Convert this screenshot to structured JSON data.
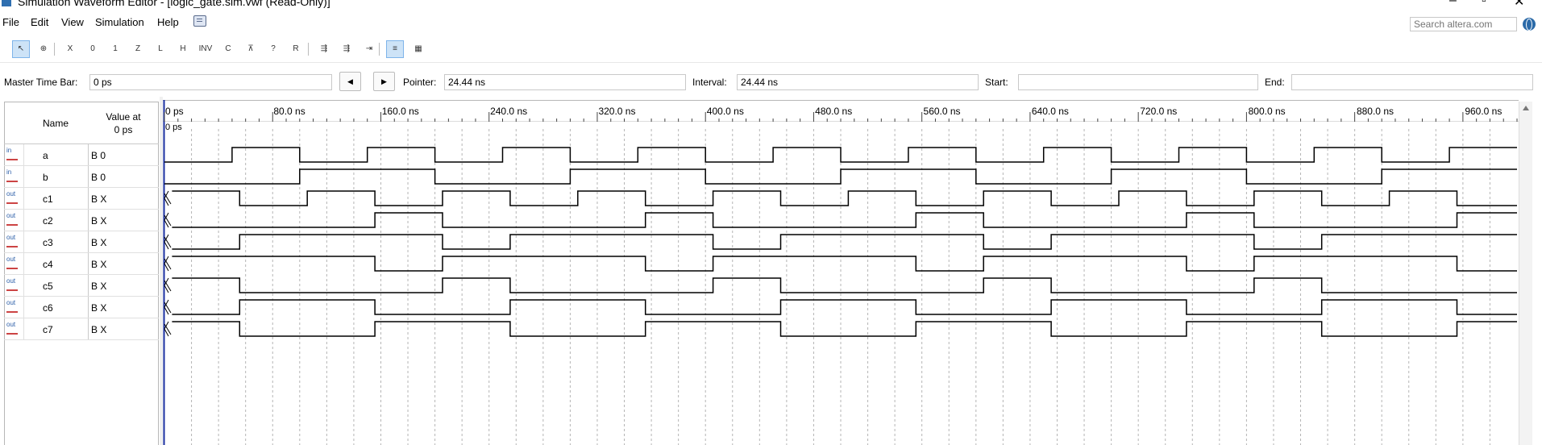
{
  "window": {
    "title": "Simulation Waveform Editor - [logic_gate.sim.vwf (Read-Only)]"
  },
  "menu": [
    "File",
    "Edit",
    "View",
    "Simulation",
    "Help"
  ],
  "search": {
    "placeholder": "Search altera.com"
  },
  "toolbar": {
    "buttons": [
      {
        "name": "selection-tool-icon",
        "glyph": "↖"
      },
      {
        "name": "zoom-tool-icon",
        "glyph": "⊕"
      },
      {
        "name": "forcing-unknown-icon",
        "glyph": "X"
      },
      {
        "name": "forcing-low-icon",
        "glyph": "0"
      },
      {
        "name": "forcing-high-icon",
        "glyph": "1"
      },
      {
        "name": "high-impedance-icon",
        "glyph": "Z"
      },
      {
        "name": "weak-low-icon",
        "glyph": "L"
      },
      {
        "name": "weak-high-icon",
        "glyph": "H"
      },
      {
        "name": "invert-icon",
        "glyph": "INV"
      },
      {
        "name": "count-value-icon",
        "glyph": "C"
      },
      {
        "name": "clock-value-icon",
        "glyph": "⊼"
      },
      {
        "name": "random-value-icon",
        "glyph": "?"
      },
      {
        "name": "arbitrary-value-icon",
        "glyph": "R"
      },
      {
        "name": "functional-sim-icon",
        "glyph": "⇶"
      },
      {
        "name": "timing-sim-icon",
        "glyph": "⇶"
      },
      {
        "name": "netlist-sim-icon",
        "glyph": "⇥"
      },
      {
        "name": "waveform-view-icon",
        "glyph": "≡"
      },
      {
        "name": "group-view-icon",
        "glyph": "▦"
      }
    ]
  },
  "timebar": {
    "master_label": "Master Time Bar:",
    "master_value": "0 ps",
    "prev_icon": "◀",
    "next_icon": "▶",
    "pointer_label": "Pointer:",
    "pointer_value": "24.44 ns",
    "interval_label": "Interval:",
    "interval_value": "24.44 ns",
    "start_label": "Start:",
    "start_value": "",
    "end_label": "End:",
    "end_value": ""
  },
  "columns": {
    "name": "Name",
    "value_line1": "Value at",
    "value_line2": "0 ps"
  },
  "ruler": {
    "ticks": [
      "0 ps",
      "80.0 ns",
      "160.0 ns",
      "240.0 ns",
      "320.0 ns",
      "400.0 ns",
      "480.0 ns",
      "560.0 ns",
      "640.0 ns",
      "720.0 ns",
      "800.0 ns",
      "880.0 ns",
      "960.0 ns"
    ],
    "cursor_label": "0 ps"
  },
  "signals": [
    {
      "dir": "in",
      "dir_label": "in",
      "name": "a",
      "value": "B 0"
    },
    {
      "dir": "in",
      "dir_label": "in",
      "name": "b",
      "value": "B 0"
    },
    {
      "dir": "out",
      "dir_label": "out",
      "name": "c1",
      "value": "B X"
    },
    {
      "dir": "out",
      "dir_label": "out",
      "name": "c2",
      "value": "B X"
    },
    {
      "dir": "out",
      "dir_label": "out",
      "name": "c3",
      "value": "B X"
    },
    {
      "dir": "out",
      "dir_label": "out",
      "name": "c4",
      "value": "B X"
    },
    {
      "dir": "out",
      "dir_label": "out",
      "name": "c5",
      "value": "B X"
    },
    {
      "dir": "out",
      "dir_label": "out",
      "name": "c6",
      "value": "B X"
    },
    {
      "dir": "out",
      "dir_label": "out",
      "name": "c7",
      "value": "B X"
    }
  ],
  "waveforms": {
    "time_end_ns": 1000,
    "unit": "ns",
    "a": {
      "initial": 0,
      "edges": [
        50,
        100,
        150,
        200,
        250,
        300,
        350,
        400,
        450,
        500,
        550,
        600,
        650,
        700,
        750,
        800,
        850,
        900,
        950
      ]
    },
    "b": {
      "initial": 0,
      "edges": [
        100,
        200,
        300,
        400,
        500,
        600,
        700,
        800,
        900
      ]
    },
    "c1": {
      "initial": 1,
      "edges": [
        55.6,
        105.6,
        155.6,
        205.6,
        255.6,
        305.6,
        355.6,
        405.6,
        455.6,
        505.6,
        555.6,
        605.6,
        655.6,
        705.6,
        755.6,
        805.6,
        855.6,
        905.6,
        955.6
      ]
    },
    "c2": {
      "initial": 0,
      "edges": [
        155.6,
        205.6,
        355.6,
        405.6,
        555.6,
        605.6,
        755.6,
        805.6,
        955.6
      ]
    },
    "c3": {
      "initial": 0,
      "edges": [
        55.6,
        205.6,
        255.6,
        405.6,
        455.6,
        605.6,
        655.6,
        805.6,
        855.6
      ]
    },
    "c4": {
      "initial": 1,
      "edges": [
        155.6,
        205.6,
        355.6,
        405.6,
        555.6,
        605.6,
        755.6,
        805.6,
        955.6
      ]
    },
    "c5": {
      "initial": 1,
      "edges": [
        55.6,
        205.6,
        255.6,
        405.6,
        455.6,
        605.6,
        655.6,
        805.6,
        855.6
      ]
    },
    "c6": {
      "initial": 0,
      "edges": [
        55.6,
        155.6,
        255.6,
        355.6,
        455.6,
        555.6,
        655.6,
        755.6,
        855.6,
        955.6
      ]
    },
    "c7": {
      "initial": 1,
      "edges": [
        55.6,
        155.6,
        255.6,
        355.6,
        455.6,
        555.6,
        655.6,
        755.6,
        855.6,
        955.6
      ]
    }
  }
}
